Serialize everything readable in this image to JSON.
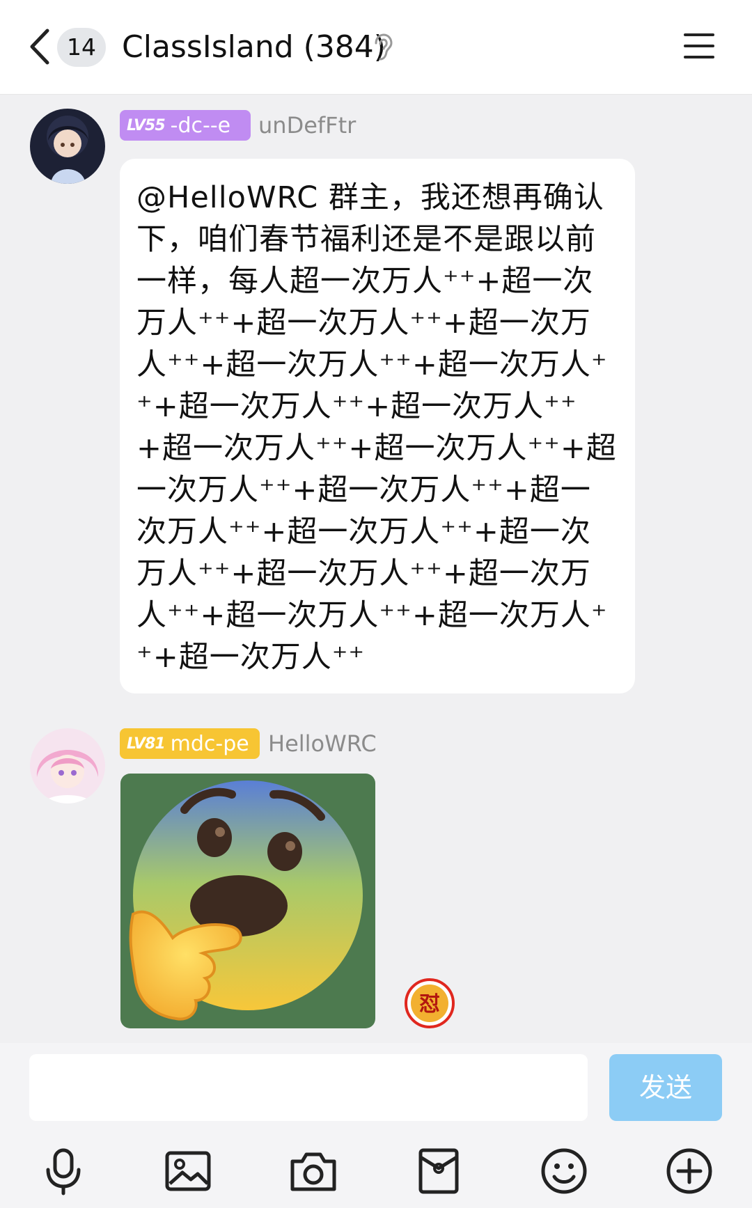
{
  "header": {
    "unread_count": "14",
    "title": "ClassIsland (384)"
  },
  "messages": [
    {
      "level": "LV55",
      "level_title": "-dc--e",
      "sender": "unDefFtr",
      "text": "@HelloWRC 群主，我还想再确认下，咱们春节福利还是不是跟以前一样，每人超一次万人⁺⁺+超一次万人⁺⁺+超一次万人⁺⁺+超一次万人⁺⁺+超一次万人⁺⁺+超一次万人⁺⁺+超一次万人⁺⁺+超一次万人⁺⁺+超一次万人⁺⁺+超一次万人⁺⁺+超一次万人⁺⁺+超一次万人⁺⁺+超一次万人⁺⁺+超一次万人⁺⁺+超一次万人⁺⁺+超一次万人⁺⁺+超一次万人⁺⁺+超一次万人⁺⁺+超一次万人⁺⁺+超一次万人⁺⁺"
    },
    {
      "level": "LV81",
      "level_title": "mdc-pe",
      "sender": "HelloWRC",
      "sticker": "thinking-fearful-face-emoji"
    }
  ],
  "reaction": {
    "glyph": "怼"
  },
  "input_bar": {
    "placeholder": "",
    "send_label": "发送"
  },
  "toolbar": [
    "microphone-icon",
    "image-icon",
    "camera-icon",
    "red-packet-icon",
    "emoji-icon",
    "plus-icon"
  ],
  "colors": {
    "lv55_badge": "#c08cf2",
    "lv81_badge": "#f7c533",
    "send_button": "#8cccf5",
    "sticker_bg": "#4d7a4f"
  }
}
